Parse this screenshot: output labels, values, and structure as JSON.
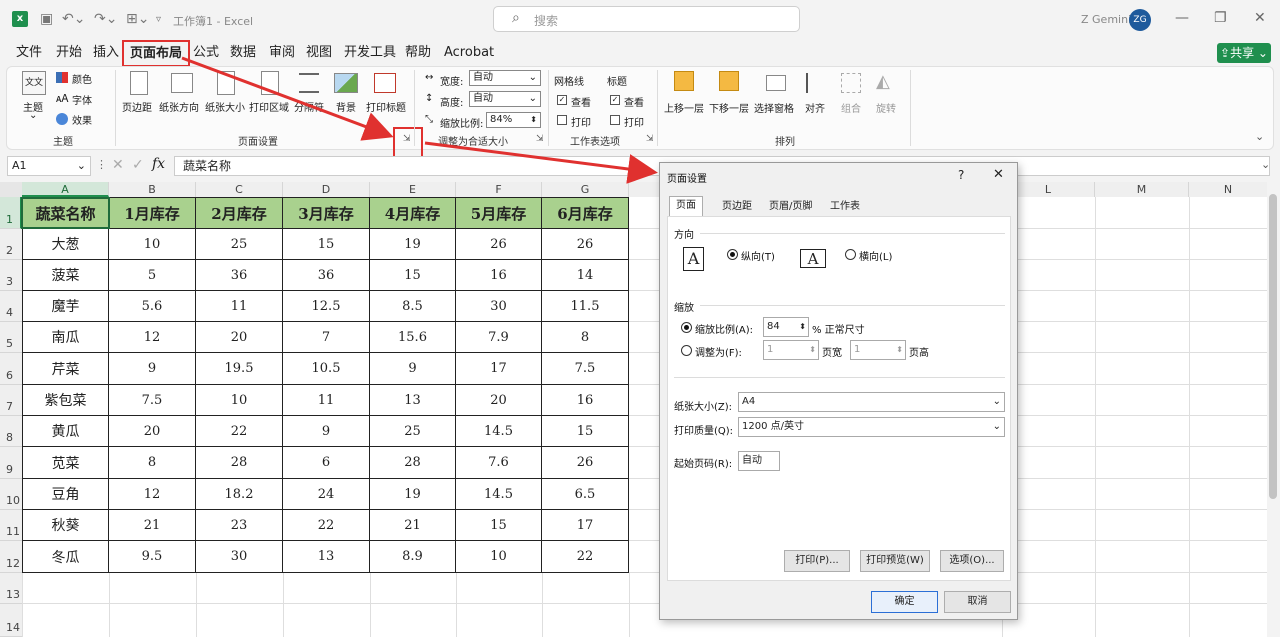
{
  "title": {
    "doc": "工作簿1 - Excel",
    "search": "搜索",
    "user": "Z Gemini",
    "avatar": "ZG"
  },
  "tabs": [
    "文件",
    "开始",
    "插入",
    "页面布局",
    "公式",
    "数据",
    "审阅",
    "视图",
    "开发工具",
    "帮助",
    "Acrobat"
  ],
  "share": "共享",
  "ribbon": {
    "theme": {
      "themes": "主题",
      "colors": "颜色",
      "fonts": "字体",
      "effects": "效果",
      "group": "主题"
    },
    "page_setup": {
      "margins": "页边距",
      "orientation": "纸张方向",
      "size": "纸张大小",
      "print_area": "打印区域",
      "breaks": "分隔符",
      "background": "背景",
      "print_titles": "打印标题",
      "group": "页面设置"
    },
    "scale": {
      "width_label": "宽度:",
      "width_val": "自动",
      "height_label": "高度:",
      "height_val": "自动",
      "scale_label": "缩放比例:",
      "scale_val": "84%",
      "group": "调整为合适大小"
    },
    "sheet_options": {
      "gridlines": "网格线",
      "headings": "标题",
      "view": "查看",
      "print": "打印",
      "group": "工作表选项"
    },
    "arrange": {
      "forward": "上移一层",
      "backward": "下移一层",
      "pane": "选择窗格",
      "align": "对齐",
      "group_btn": "组合",
      "rotate": "旋转",
      "group": "排列"
    }
  },
  "formula": {
    "namebox": "A1",
    "content": "蔬菜名称"
  },
  "columns": [
    "A",
    "B",
    "C",
    "D",
    "E",
    "F",
    "G",
    "L",
    "M",
    "N"
  ],
  "rows": [
    "1",
    "2",
    "3",
    "4",
    "5",
    "6",
    "7",
    "8",
    "9",
    "10",
    "11",
    "12",
    "13",
    "14"
  ],
  "table": {
    "headers": [
      "蔬菜名称",
      "1月库存",
      "2月库存",
      "3月库存",
      "4月库存",
      "5月库存",
      "6月库存"
    ],
    "data": [
      [
        "大葱",
        "10",
        "25",
        "15",
        "19",
        "26",
        "26"
      ],
      [
        "菠菜",
        "5",
        "36",
        "36",
        "15",
        "16",
        "14"
      ],
      [
        "魔芋",
        "5.6",
        "11",
        "12.5",
        "8.5",
        "30",
        "11.5"
      ],
      [
        "南瓜",
        "12",
        "20",
        "7",
        "15.6",
        "7.9",
        "8"
      ],
      [
        "芹菜",
        "9",
        "19.5",
        "10.5",
        "9",
        "17",
        "7.5"
      ],
      [
        "紫包菜",
        "7.5",
        "10",
        "11",
        "13",
        "20",
        "16"
      ],
      [
        "黄瓜",
        "20",
        "22",
        "9",
        "25",
        "14.5",
        "15"
      ],
      [
        "苋菜",
        "8",
        "28",
        "6",
        "28",
        "7.6",
        "26"
      ],
      [
        "豆角",
        "12",
        "18.2",
        "24",
        "19",
        "14.5",
        "6.5"
      ],
      [
        "秋葵",
        "21",
        "23",
        "22",
        "21",
        "15",
        "17"
      ],
      [
        "冬瓜",
        "9.5",
        "30",
        "13",
        "8.9",
        "10",
        "22"
      ]
    ]
  },
  "dialog": {
    "title": "页面设置",
    "help": "?",
    "close": "✕",
    "tabs": [
      "页面",
      "页边距",
      "页眉/页脚",
      "工作表"
    ],
    "orientation": "方向",
    "portrait": "纵向(T)",
    "landscape": "横向(L)",
    "scaling": "缩放",
    "adjust": "缩放比例(A):",
    "adjust_val": "84",
    "pct": "% 正常尺寸",
    "fit": "调整为(F):",
    "fit_w": "1",
    "pages_wide": "页宽",
    "fit_h": "1",
    "pages_tall": "页高",
    "paper_size_label": "纸张大小(Z):",
    "paper_size": "A4",
    "quality_label": "打印质量(Q):",
    "quality": "1200 点/英寸",
    "first_page_label": "起始页码(R):",
    "first_page": "自动",
    "print": "打印(P)...",
    "preview": "打印预览(W)",
    "options": "选项(O)...",
    "ok": "确定",
    "cancel": "取消"
  },
  "colors": {
    "accent": "#1f8f4e",
    "header_fill": "#a9d18e",
    "annotation": "#e0312f",
    "ok_border": "#2b6fd6"
  }
}
